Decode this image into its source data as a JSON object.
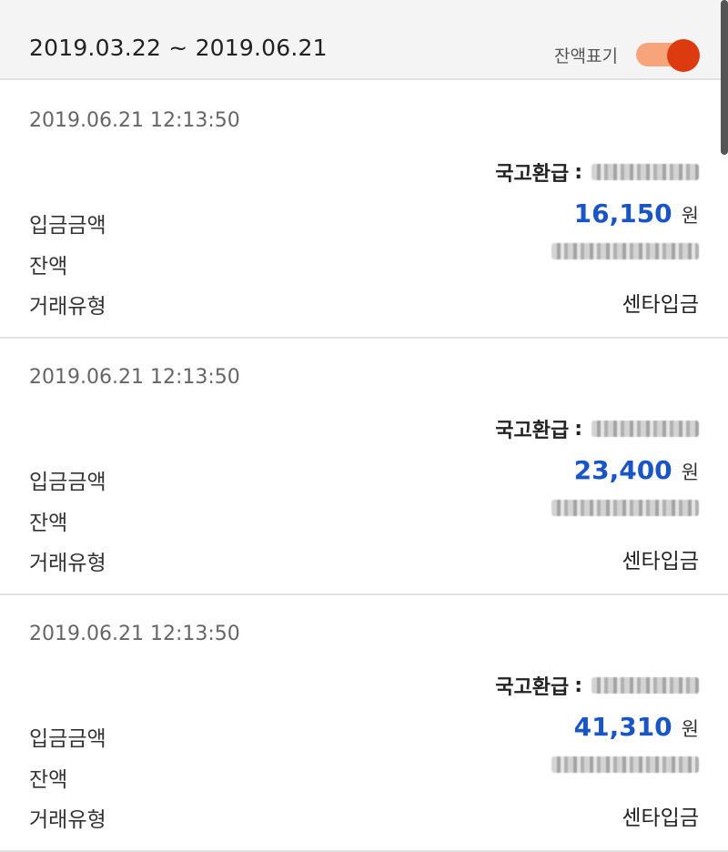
{
  "header": {
    "period": "2019.03.22 ~ 2019.06.21",
    "balance_toggle_label": "잔액표기",
    "balance_toggle_on": true,
    "accent_color": "#dd3a10"
  },
  "labels": {
    "deposit_amount": "입금금액",
    "balance": "잔액",
    "transaction_type": "거래유형",
    "currency": "원",
    "refund_prefix": "국고환급",
    "refund_colon": ":"
  },
  "transactions": [
    {
      "datetime": "2019.06.21 12:13:50",
      "amount": "16,150",
      "type": "센타입금"
    },
    {
      "datetime": "2019.06.21 12:13:50",
      "amount": "23,400",
      "type": "센타입금"
    },
    {
      "datetime": "2019.06.21 12:13:50",
      "amount": "41,310",
      "type": "센타입금"
    }
  ]
}
